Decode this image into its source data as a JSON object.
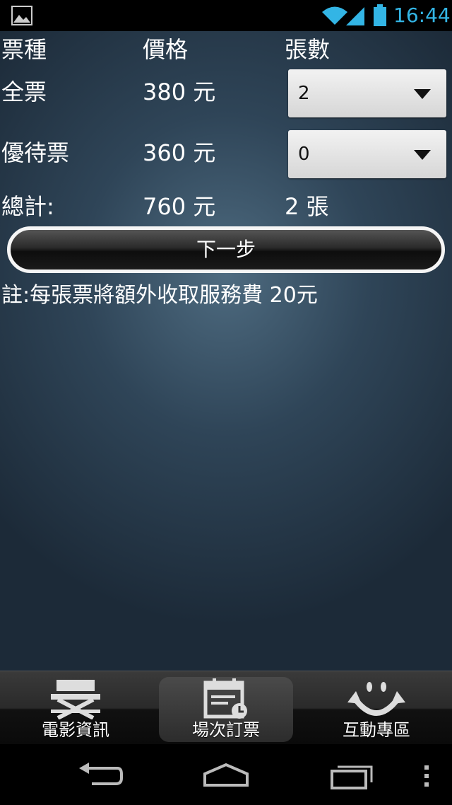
{
  "status_bar": {
    "time": "16:44",
    "icons": [
      "gallery-icon",
      "wifi-icon",
      "signal-icon",
      "battery-icon"
    ],
    "clock_color": "#33b5e5"
  },
  "table": {
    "headers": [
      "票種",
      "價格",
      "張數"
    ],
    "rows": [
      {
        "type": "全票",
        "price": "380 元",
        "quantity": "2"
      },
      {
        "type": "優待票",
        "price": "360 元",
        "quantity": "0"
      }
    ],
    "total": {
      "label": "總計:",
      "price": "760 元",
      "count": "2 張"
    }
  },
  "next_button": {
    "label": "下一步"
  },
  "note": "註:每張票將額外收取服務費 20元",
  "tabs": [
    {
      "label": "電影資訊",
      "icon": "directors-chair-icon",
      "active": false
    },
    {
      "label": "場次訂票",
      "icon": "calendar-clock-icon",
      "active": true
    },
    {
      "label": "互動專區",
      "icon": "smiley-arrows-icon",
      "active": false
    }
  ],
  "nav_bar": {
    "icons": [
      "back-icon",
      "home-icon",
      "recent-apps-icon",
      "menu-icon"
    ]
  }
}
